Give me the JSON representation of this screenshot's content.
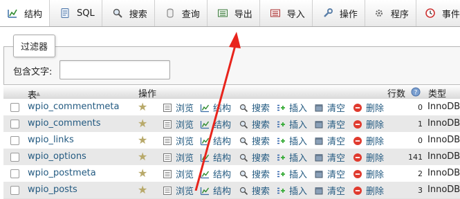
{
  "tabs": [
    {
      "label": "结构",
      "icon": "structure-icon"
    },
    {
      "label": "SQL",
      "icon": "sql-icon"
    },
    {
      "label": "搜索",
      "icon": "search-icon"
    },
    {
      "label": "查询",
      "icon": "query-icon"
    },
    {
      "label": "导出",
      "icon": "export-icon"
    },
    {
      "label": "导入",
      "icon": "import-icon"
    },
    {
      "label": "操作",
      "icon": "wrench-icon"
    },
    {
      "label": "程序",
      "icon": "routines-icon"
    },
    {
      "label": "事件",
      "icon": "clock-icon"
    }
  ],
  "filter": {
    "legend": "过滤器",
    "label": "包含文字:",
    "value": ""
  },
  "table_header": {
    "table": "表",
    "sort_indicator": "▲",
    "action": "操作",
    "rows": "行数",
    "type": "类型"
  },
  "actions": {
    "browse": "浏览",
    "structure": "结构",
    "search": "搜索",
    "insert": "插入",
    "empty": "清空",
    "drop": "删除"
  },
  "tables": [
    {
      "name": "wpio_commentmeta",
      "rows": "0",
      "engine": "InnoDB"
    },
    {
      "name": "wpio_comments",
      "rows": "1",
      "engine": "InnoDB"
    },
    {
      "name": "wpio_links",
      "rows": "0",
      "engine": "InnoDB"
    },
    {
      "name": "wpio_options",
      "rows": "141",
      "engine": "InnoDB"
    },
    {
      "name": "wpio_postmeta",
      "rows": "2",
      "engine": "InnoDB"
    },
    {
      "name": "wpio_posts",
      "rows": "3",
      "engine": "InnoDB"
    }
  ],
  "colors": {
    "link": "#235a81",
    "arrow": "#e8241c",
    "row_alt": "#e8e8e8"
  }
}
